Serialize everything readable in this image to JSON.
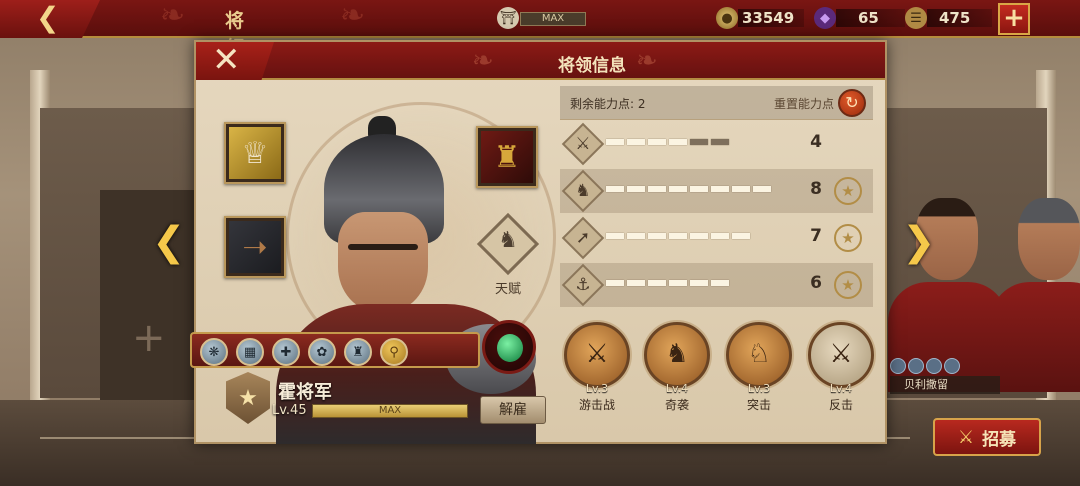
{
  "topbar": {
    "title": "将 领",
    "max_label": "MAX",
    "coins": "33549",
    "gems": "65",
    "scrolls": "475"
  },
  "modal": {
    "title": "将领信息",
    "points": {
      "label": "剩余能力点: 2",
      "reset_label": "重置能力点"
    },
    "stats": [
      {
        "icon": "sword-icon",
        "value": "4",
        "filled": 4,
        "total": 6
      },
      {
        "icon": "horse-icon",
        "value": "8",
        "filled": 8,
        "total": 8
      },
      {
        "icon": "bow-icon",
        "value": "7",
        "filled": 7,
        "total": 7
      },
      {
        "icon": "anchor-icon",
        "value": "6",
        "filled": 6,
        "total": 6
      }
    ],
    "talent_label": "天赋",
    "skills": [
      {
        "level": "Lv.3",
        "name": "游击战"
      },
      {
        "level": "Lv.4",
        "name": "奇袭"
      },
      {
        "level": "Lv.3",
        "name": "突击"
      },
      {
        "level": "Lv.4",
        "name": "反击"
      }
    ],
    "hero": {
      "name": "霍将军",
      "level": "Lv.45",
      "xp_label": "MAX",
      "dismiss_label": "解雇"
    }
  },
  "side": {
    "right_name": "贝利撒留",
    "recruit_label": "招募"
  }
}
